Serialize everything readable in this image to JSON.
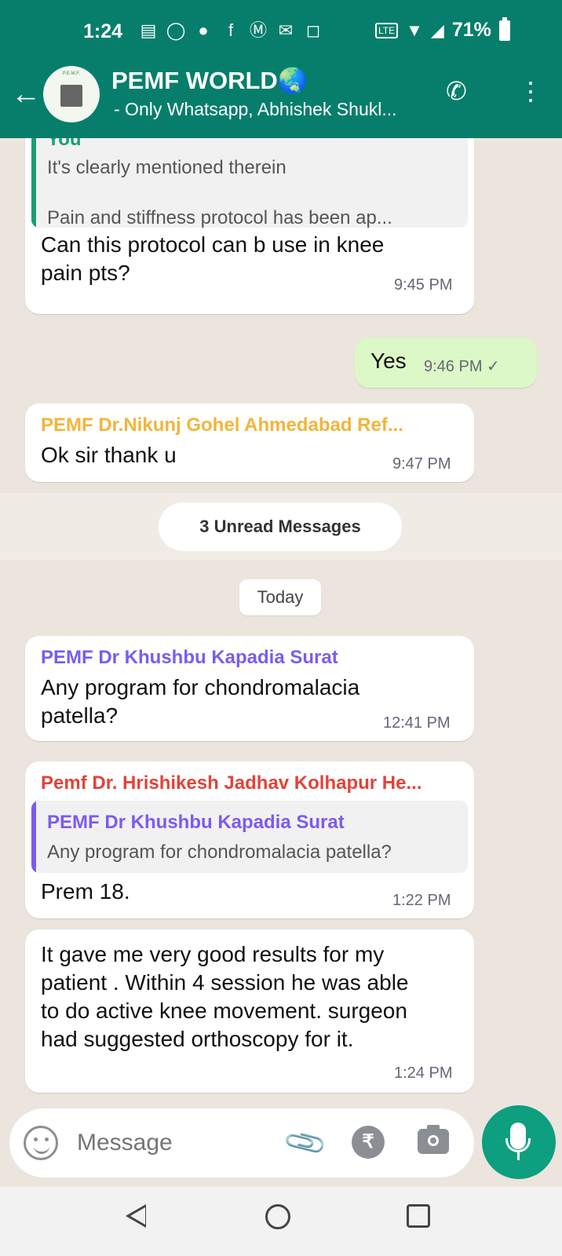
{
  "status_bar": {
    "time": "1:24",
    "battery": "71%",
    "icons": [
      "notes-icon",
      "whatsapp-icon",
      "messages-icon",
      "facebook-icon",
      "moneycontrol-icon",
      "mail-icon",
      "instagram-icon",
      "volte-icon",
      "wifi-icon",
      "signal-icon",
      "battery-icon"
    ]
  },
  "header": {
    "title": "PEMF WORLD🌏",
    "subtitle": "- Only Whatsapp, Abhishek Shukl...",
    "avatar_text": "P.E.M.F."
  },
  "messages": [
    {
      "quote_sender": "You",
      "quote_line1": "It's clearly mentioned therein",
      "quote_line2": "Pain and stiffness protocol has been ap...",
      "text_line1": "Can this protocol can b use in knee",
      "text_line2": "pain pts?",
      "time": "9:45 PM"
    },
    {
      "text": "Yes",
      "time": "9:46 PM ✓"
    },
    {
      "sender": "PEMF Dr.Nikunj  Gohel Ahmedabad Ref...",
      "text": "Ok sir thank u",
      "time": "9:47 PM"
    },
    {
      "sender": "PEMF Dr Khushbu Kapadia Surat",
      "text_line1": "Any program for chondromalacia",
      "text_line2": "patella?",
      "time": "12:41 PM"
    },
    {
      "sender": "Pemf Dr. Hrishikesh Jadhav Kolhapur He...",
      "quote_sender": "PEMF Dr Khushbu Kapadia Surat",
      "quote_text": "Any program for chondromalacia patella?",
      "text": "Prem 18.",
      "time": "1:22 PM"
    },
    {
      "text_line1": "It gave me very good results for my",
      "text_line2": "patient . Within 4 session he was able",
      "text_line3": "to do active knee movement. surgeon",
      "text_line4": "had suggested orthoscopy for it.",
      "time": "1:24 PM"
    }
  ],
  "unread_label": "3 Unread Messages",
  "date_label": "Today",
  "composer": {
    "placeholder": "Message",
    "rupee": "₹"
  },
  "colors": {
    "header": "#077e6b",
    "mic_button": "#0d9f7f",
    "sender_nikunj": "#f2b53a",
    "sender_khushbu": "#7a5cf0",
    "sender_hrishikesh": "#e0443a",
    "outgoing_bubble": "#dcf8c6"
  }
}
